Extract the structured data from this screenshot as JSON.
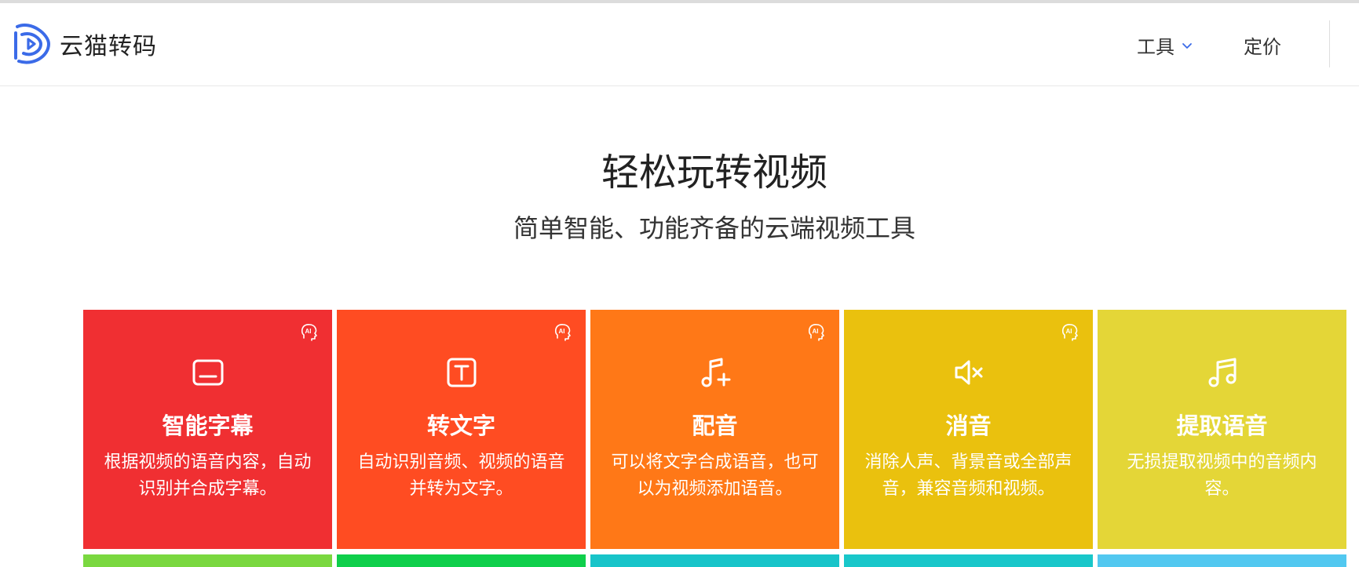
{
  "header": {
    "brand": "云猫转码",
    "nav": {
      "tools_label": "工具",
      "price_label": "定价"
    }
  },
  "hero": {
    "title": "轻松玩转视频",
    "subtitle": "简单智能、功能齐备的云端视频工具"
  },
  "cards": [
    {
      "title": "智能字幕",
      "desc": "根据视频的语音内容，自动识别并合成字幕。",
      "color": "#F02F32",
      "icon": "subtitle-icon",
      "ai": true
    },
    {
      "title": "转文字",
      "desc": "自动识别音频、视频的语音并转为文字。",
      "color": "#FF4C22",
      "icon": "text-icon",
      "ai": true
    },
    {
      "title": "配音",
      "desc": "可以将文字合成语音，也可以为视频添加语音。",
      "color": "#FF7817",
      "icon": "music-add-icon",
      "ai": true
    },
    {
      "title": "消音",
      "desc": "消除人声、背景音或全部声音，兼容音频和视频。",
      "color": "#EAC10E",
      "icon": "mute-icon",
      "ai": true
    },
    {
      "title": "提取语音",
      "desc": "无损提取视频中的音频内容。",
      "color": "#E4D637",
      "icon": "music-icon",
      "ai": false
    }
  ],
  "bottom_strip_colors": [
    "#7AD840",
    "#0FCF4B",
    "#18C4C9",
    "#19C7CA",
    "#52C8F0"
  ],
  "colors": {
    "accent": "#3B6BE8"
  }
}
